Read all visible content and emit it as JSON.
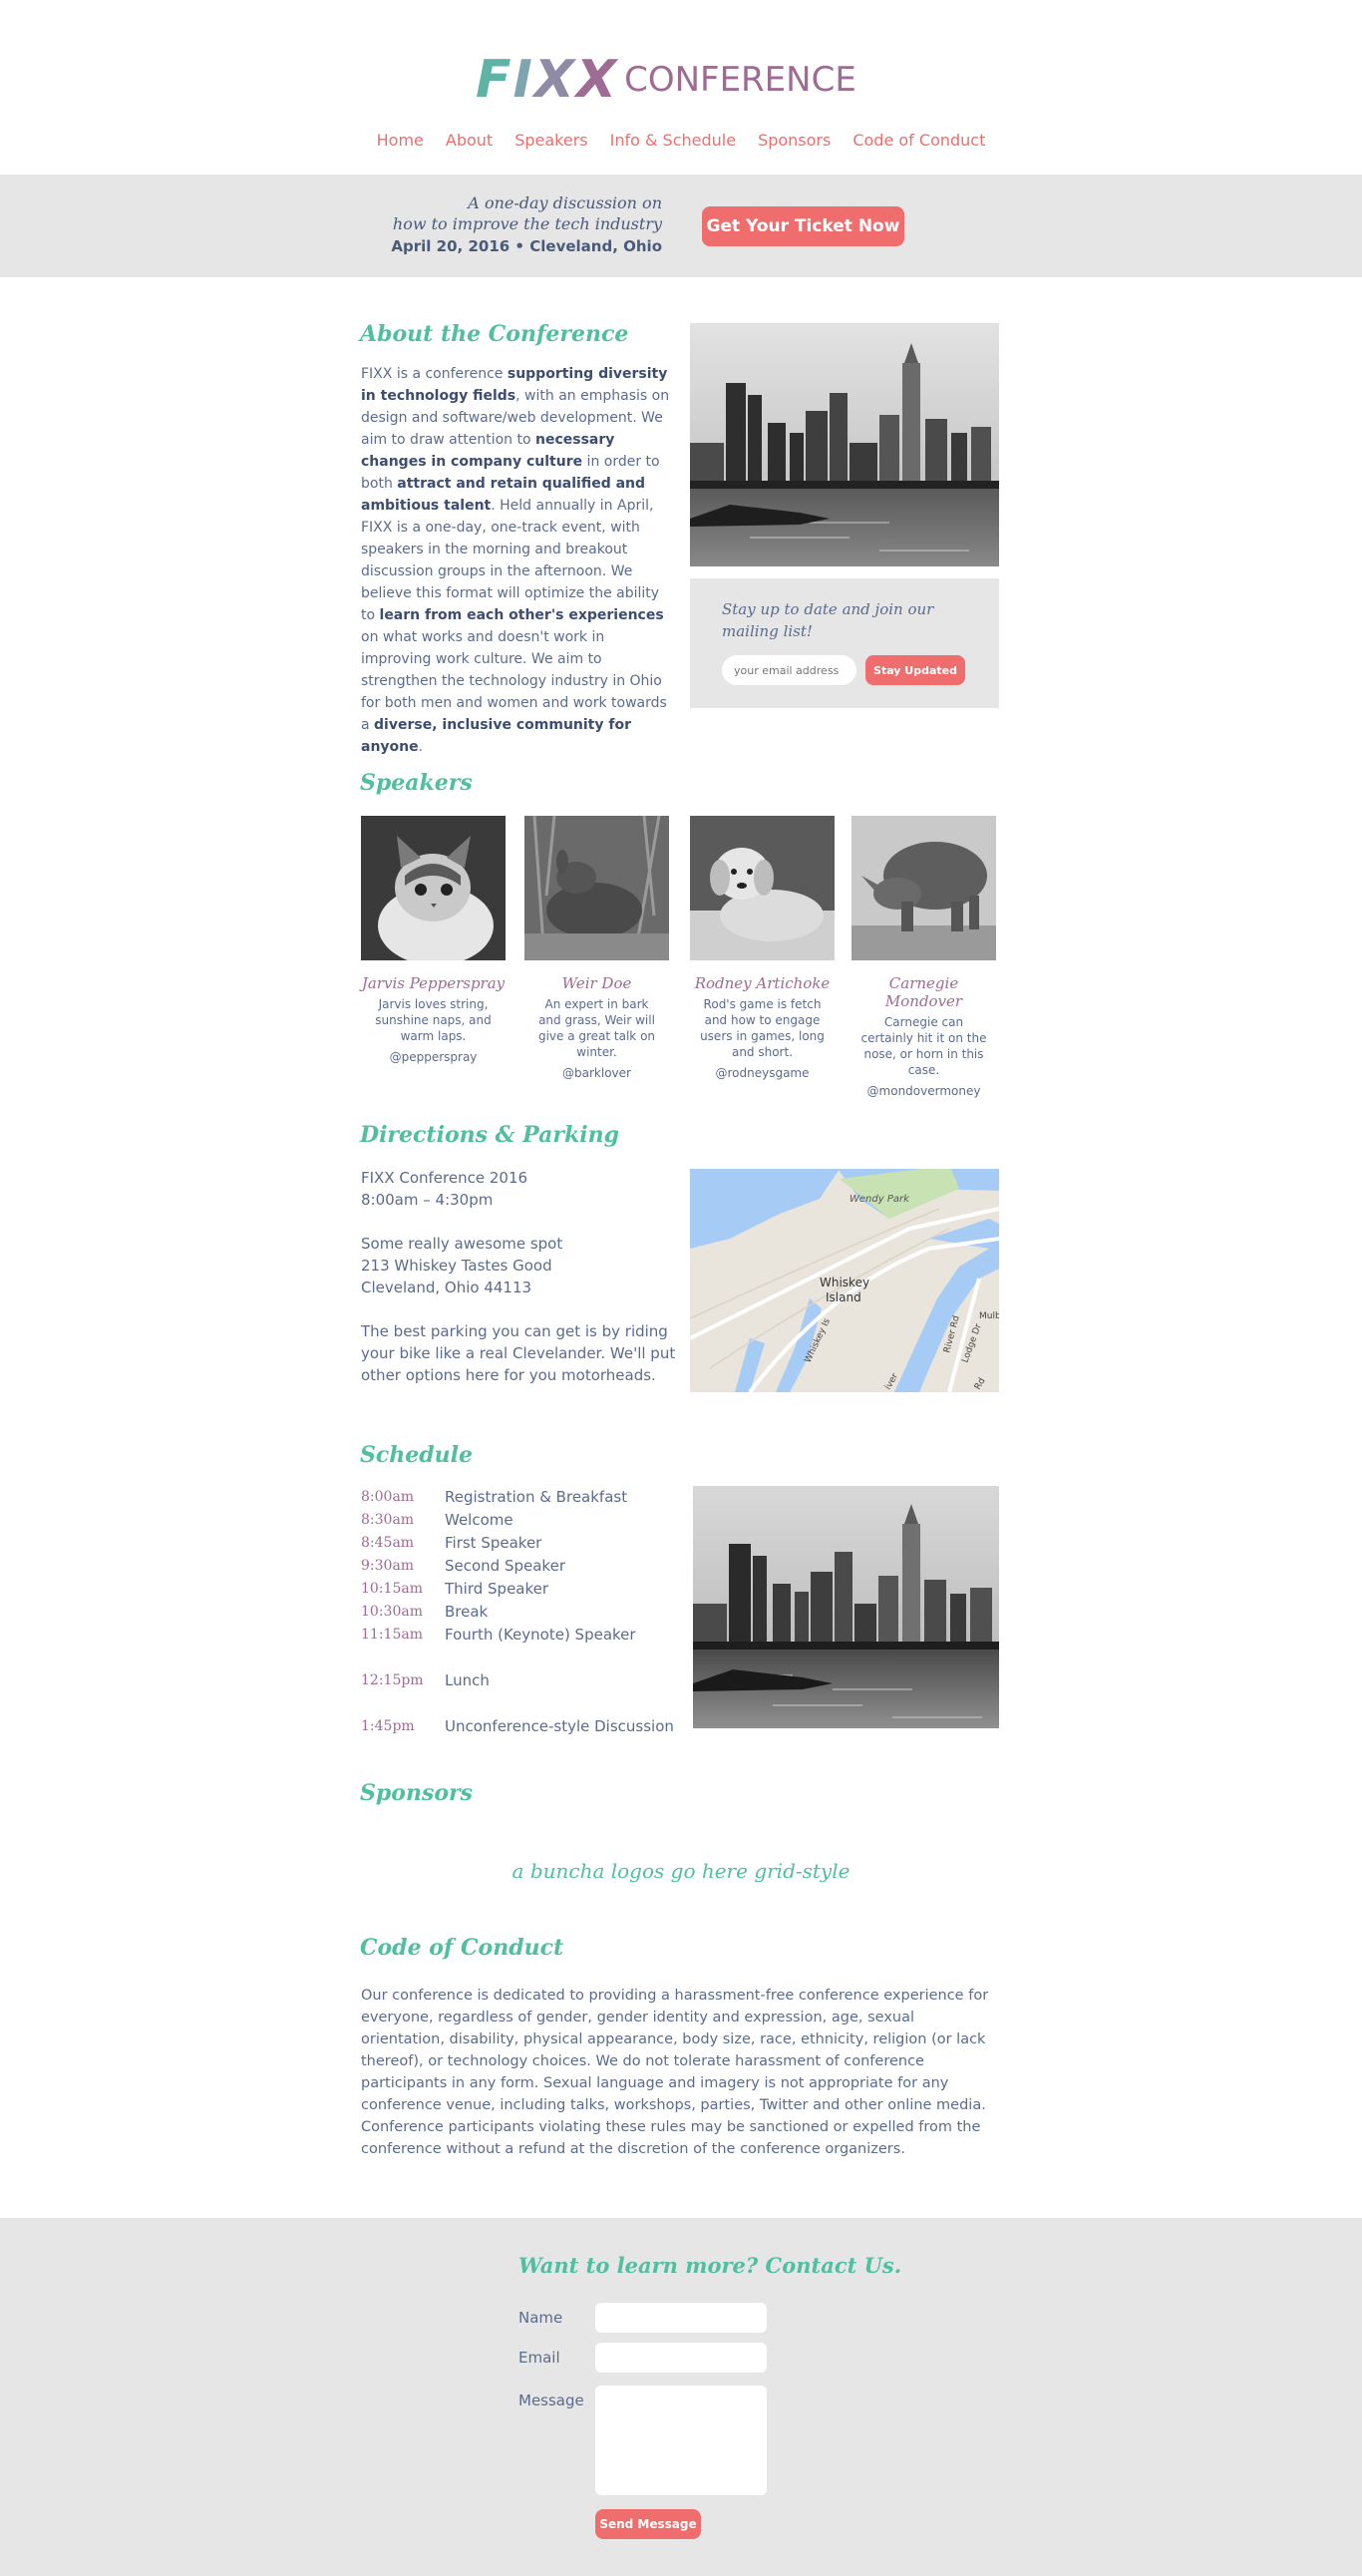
{
  "logo": {
    "brand": "FIXX",
    "word": "CONFERENCE"
  },
  "nav": [
    "Home",
    "About",
    "Speakers",
    "Info & Schedule",
    "Sponsors",
    "Code of Conduct"
  ],
  "ticket_bar": {
    "tagline_line1": "A one-day discussion on",
    "tagline_line2": "how to improve the tech industry",
    "date_location": "April 20, 2016  •  Cleveland, Ohio",
    "button": "Get Your Ticket Now"
  },
  "about": {
    "title": "About the Conference",
    "segments": [
      {
        "t": "FIXX is a conference ",
        "b": false
      },
      {
        "t": "supporting diversity in technology fields",
        "b": true
      },
      {
        "t": ", with an emphasis on design and software/web development. We aim to draw attention to ",
        "b": false
      },
      {
        "t": "necessary changes in company culture",
        "b": true
      },
      {
        "t": " in order to both ",
        "b": false
      },
      {
        "t": "attract and retain qualified and ambitious talent",
        "b": true
      },
      {
        "t": ". Held annually in April, FIXX is a one-day, one-track event, with speakers in the morning and breakout discussion groups in the afternoon. We believe this format will optimize the ability to ",
        "b": false
      },
      {
        "t": "learn from each other's experiences",
        "b": true
      },
      {
        "t": " on what works and doesn't work in improving work culture. We aim to strengthen the technology industry in Ohio for both men and women and work towards a ",
        "b": false
      },
      {
        "t": "diverse, inclusive community for anyone",
        "b": true
      },
      {
        "t": ".",
        "b": false
      }
    ]
  },
  "mailing": {
    "text": "Stay up to date and join our mailing list!",
    "placeholder": "your email address",
    "button": "Stay Updated"
  },
  "speakers": {
    "title": "Speakers",
    "items": [
      {
        "name": "Jarvis Pepperspray",
        "bio": "Jarvis loves string, sunshine naps, and warm laps.",
        "handle": "@pepperspray",
        "photo": "kitten"
      },
      {
        "name": "Weir Doe",
        "bio": "An expert in bark and grass, Weir will give a great talk on winter.",
        "handle": "@barklover",
        "photo": "deer"
      },
      {
        "name": "Rodney Artichoke",
        "bio": "Rod's game is fetch and how to engage users in games, long and short.",
        "handle": "@rodneysgame",
        "photo": "puppy"
      },
      {
        "name": "Carnegie Mondover",
        "bio": "Carnegie can certainly hit it on the nose, or horn in this case.",
        "handle": "@mondovermoney",
        "photo": "rhino"
      }
    ]
  },
  "directions": {
    "title": "Directions & Parking",
    "event": "FIXX Conference 2016",
    "time": "8:00am – 4:30pm",
    "venue": "Some really awesome spot",
    "street": "213 Whiskey Tastes Good",
    "city": "Cleveland, Ohio 44113",
    "parking": "The best parking you can get is by riding your bike like a real Clevelander. We'll put other options here for you motorheads.",
    "map_labels": {
      "park": "Wendy Park",
      "island1": "Whiskey",
      "island2": "Island",
      "road1": "Whiskey Is",
      "road2": "River Rd",
      "road3": "Lodge Dr",
      "road4": "Mulb",
      "road5": "iver",
      "road6": "Rd"
    }
  },
  "schedule": {
    "title": "Schedule",
    "rows": [
      {
        "time": "8:00am",
        "event": "Registration & Breakfast",
        "gap": false
      },
      {
        "time": "8:30am",
        "event": "Welcome",
        "gap": false
      },
      {
        "time": "8:45am",
        "event": "First Speaker",
        "gap": false
      },
      {
        "time": "9:30am",
        "event": "Second Speaker",
        "gap": false
      },
      {
        "time": "10:15am",
        "event": "Third Speaker",
        "gap": false
      },
      {
        "time": "10:30am",
        "event": "Break",
        "gap": false
      },
      {
        "time": "11:15am",
        "event": "Fourth (Keynote) Speaker",
        "gap": false
      },
      {
        "time": "12:15pm",
        "event": "Lunch",
        "gap": true
      },
      {
        "time": "1:45pm",
        "event": "Unconference-style Discussion",
        "gap": true
      }
    ]
  },
  "sponsors": {
    "title": "Sponsors",
    "note": "a buncha logos go here grid-style"
  },
  "code_of_conduct": {
    "title": "Code of Conduct",
    "text": "Our conference is dedicated to providing a harassment-free conference experience for everyone, regardless of gender, gender identity and expression, age, sexual orientation, disability, physical appearance, body size, race, ethnicity, religion (or lack thereof), or technology choices. We do not tolerate harassment of conference participants in any form. Sexual language and imagery is not appropriate for any conference venue, including talks, workshops, parties, Twitter and other online media. Conference participants violating these rules may be sanctioned or expelled from the conference without a refund at the discretion of the conference organizers."
  },
  "contact": {
    "title": "Want to learn more? Contact Us.",
    "name_label": "Name",
    "email_label": "Email",
    "message_label": "Message",
    "button": "Send Message"
  },
  "colors": {
    "accent_red": "#ef6d6d",
    "teal": "#4fbfa0",
    "purple": "#9e6b93",
    "bar_gray": "#e6e6e6"
  }
}
